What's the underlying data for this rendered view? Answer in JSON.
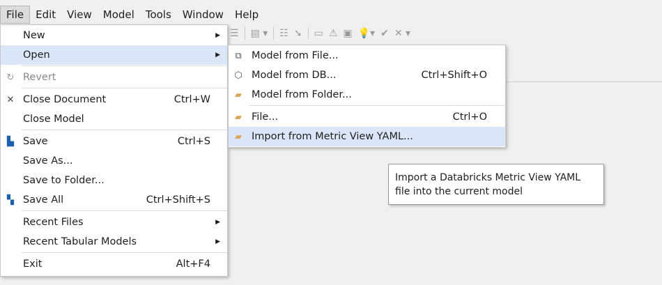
{
  "menubar": [
    "File",
    "Edit",
    "View",
    "Model",
    "Tools",
    "Window",
    "Help"
  ],
  "file_menu": {
    "groups": [
      [
        {
          "label": "New",
          "submenu": true
        },
        {
          "label": "Open",
          "submenu": true,
          "highlighted": true
        }
      ],
      [
        {
          "label": "Revert",
          "icon": "revert-icon",
          "disabled": true
        }
      ],
      [
        {
          "label": "Close Document",
          "shortcut": "Ctrl+W",
          "icon": "close-icon"
        },
        {
          "label": "Close Model"
        }
      ],
      [
        {
          "label": "Save",
          "shortcut": "Ctrl+S",
          "icon": "save-icon"
        },
        {
          "label": "Save As..."
        },
        {
          "label": "Save to Folder..."
        },
        {
          "label": "Save All",
          "shortcut": "Ctrl+Shift+S",
          "icon": "save-all-icon"
        }
      ],
      [
        {
          "label": "Recent Files",
          "submenu": true
        },
        {
          "label": "Recent Tabular Models",
          "submenu": true
        }
      ],
      [
        {
          "label": "Exit",
          "shortcut": "Alt+F4"
        }
      ]
    ]
  },
  "open_submenu": {
    "groups": [
      [
        {
          "label": "Model from File...",
          "icon": "model-file-icon"
        },
        {
          "label": "Model from DB...",
          "shortcut": "Ctrl+Shift+O",
          "icon": "model-db-icon"
        },
        {
          "label": "Model from Folder...",
          "icon": "folder-open-icon"
        }
      ],
      [
        {
          "label": "File...",
          "shortcut": "Ctrl+O",
          "icon": "folder-open-icon"
        },
        {
          "label": "Import from Metric View YAML...",
          "icon": "folder-open-icon",
          "highlighted": true
        }
      ]
    ]
  },
  "tooltip": {
    "text": "Import a Databricks Metric View YAML file into the current model"
  },
  "colors": {
    "highlight": "#dbe7f8",
    "save_icon": "#1b5fae"
  }
}
